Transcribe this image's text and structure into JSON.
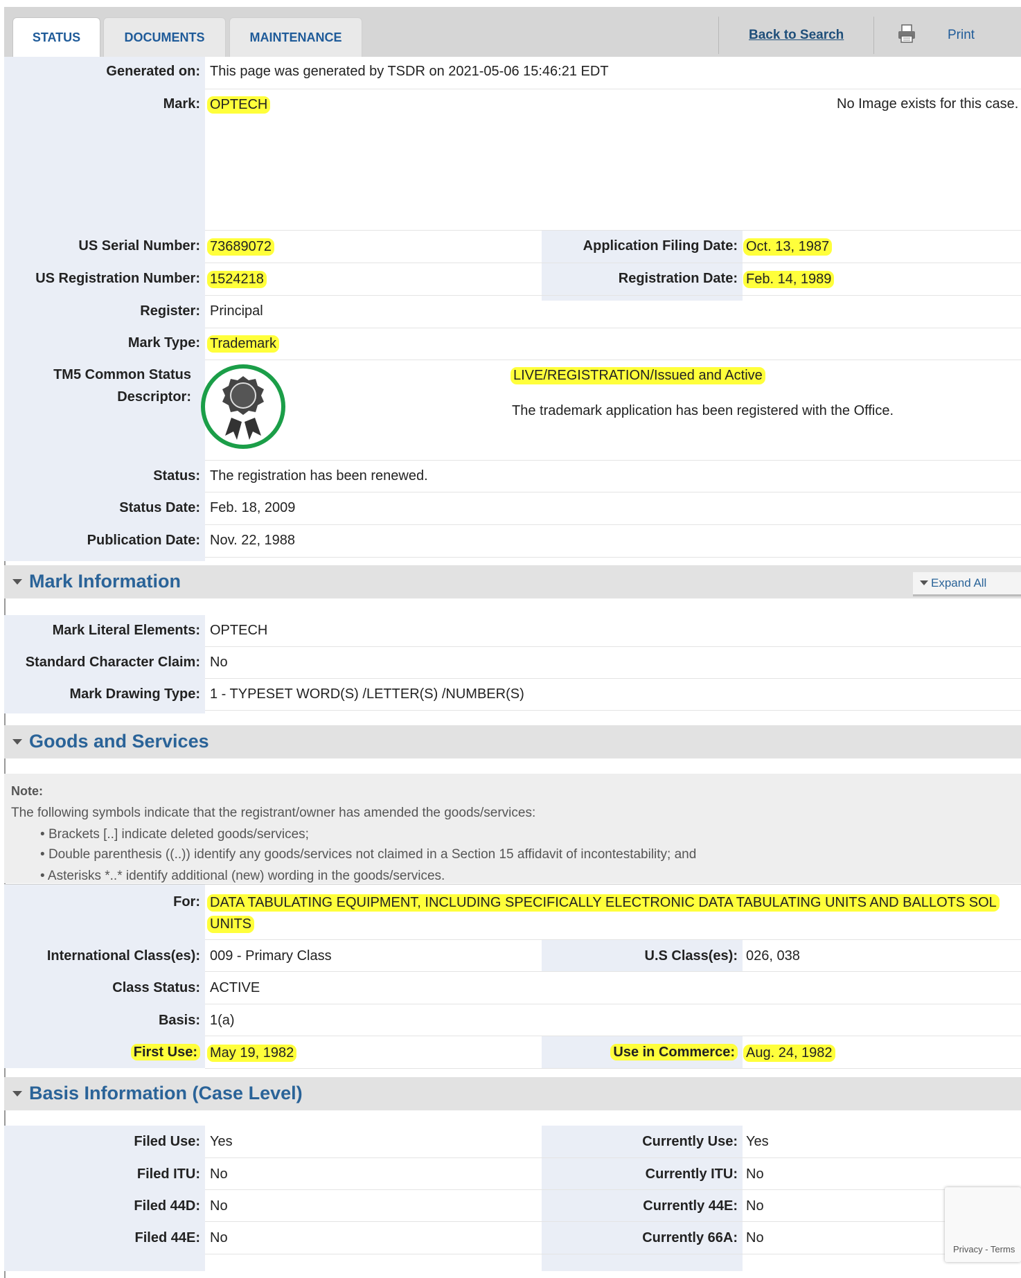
{
  "tabs": [
    {
      "label": "STATUS"
    },
    {
      "label": "DOCUMENTS"
    },
    {
      "label": "MAINTENANCE"
    }
  ],
  "toolbar": {
    "back_label": "Back to Search",
    "print_label": "Print"
  },
  "status": {
    "generated_label": "Generated on:",
    "generated_value": "This page was generated by TSDR on 2021-05-06 15:46:21 EDT",
    "mark_label": "Mark:",
    "mark_value": "OPTECH",
    "no_image": "No Image exists for this case.",
    "serial_label": "US Serial Number:",
    "serial_value": "73689072",
    "filing_label": "Application Filing Date:",
    "filing_value": "Oct. 13, 1987",
    "reg_label": "US Registration Number:",
    "reg_value": "1524218",
    "reg_date_label": "Registration Date:",
    "reg_date_value": "Feb. 14, 1989",
    "register_label": "Register:",
    "register_value": "Principal",
    "mark_type_label": "Mark Type:",
    "mark_type_value": "Trademark",
    "tm5_label_1": "TM5 Common Status",
    "tm5_label_2": "Descriptor:",
    "tm5_value": "LIVE/REGISTRATION/Issued and Active",
    "tm5_desc": "The trademark application has been registered with the Office.",
    "status_label": "Status:",
    "status_value": "The registration has been renewed.",
    "status_date_label": "Status Date:",
    "status_date_value": "Feb. 18, 2009",
    "pub_label": "Publication Date:",
    "pub_value": "Nov. 22, 1988"
  },
  "mark_info": {
    "title": "Mark Information",
    "expand_all": "Expand All",
    "literal_label": "Mark Literal Elements:",
    "literal_value": "OPTECH",
    "std_label": "Standard Character Claim:",
    "std_value": "No",
    "drawing_label": "Mark Drawing Type:",
    "drawing_value": "1 - TYPESET WORD(S) /LETTER(S) /NUMBER(S)"
  },
  "goods": {
    "title": "Goods and Services",
    "note_title": "Note:",
    "note_intro": "The following symbols indicate that the registrant/owner has amended the goods/services:",
    "bullets": [
      "Brackets [..] indicate deleted goods/services;",
      "Double parenthesis ((..)) identify any goods/services not claimed in a Section 15 affidavit of incontestability; and",
      "Asterisks *..* identify additional (new) wording in the goods/services."
    ],
    "for_label": "For:",
    "for_value_1": "DATA TABULATING EQUIPMENT, INCLUDING SPECIFICALLY ELECTRONIC DATA TABULATING UNITS AND BALLOTS SOL",
    "for_value_2": "UNITS",
    "intl_label": "International Class(es):",
    "intl_value": "009 - Primary Class",
    "us_class_label": "U.S Class(es):",
    "us_class_value": "026, 038",
    "class_status_label": "Class Status:",
    "class_status_value": "ACTIVE",
    "basis_label": "Basis:",
    "basis_value": "1(a)",
    "first_use_label": "First Use:",
    "first_use_value": "May 19, 1982",
    "commerce_label": "Use in Commerce:",
    "commerce_value": "Aug. 24, 1982"
  },
  "basis": {
    "title": "Basis Information (Case Level)",
    "rows": [
      {
        "l1": "Filed Use:",
        "v1": "Yes",
        "l2": "Currently Use:",
        "v2": "Yes"
      },
      {
        "l1": "Filed ITU:",
        "v1": "No",
        "l2": "Currently ITU:",
        "v2": "No"
      },
      {
        "l1": "Filed 44D:",
        "v1": "No",
        "l2": "Currently 44E:",
        "v2": "No"
      },
      {
        "l1": "Filed 44E:",
        "v1": "No",
        "l2": "Currently 66A:",
        "v2": "No"
      }
    ]
  },
  "recaptcha": {
    "footer": "Privacy - Terms"
  },
  "colors": {
    "highlight": "#ffff3b",
    "label_bg": "#eaeef6",
    "section_title": "#2a6398",
    "badge_ring": "#1b9e48"
  }
}
